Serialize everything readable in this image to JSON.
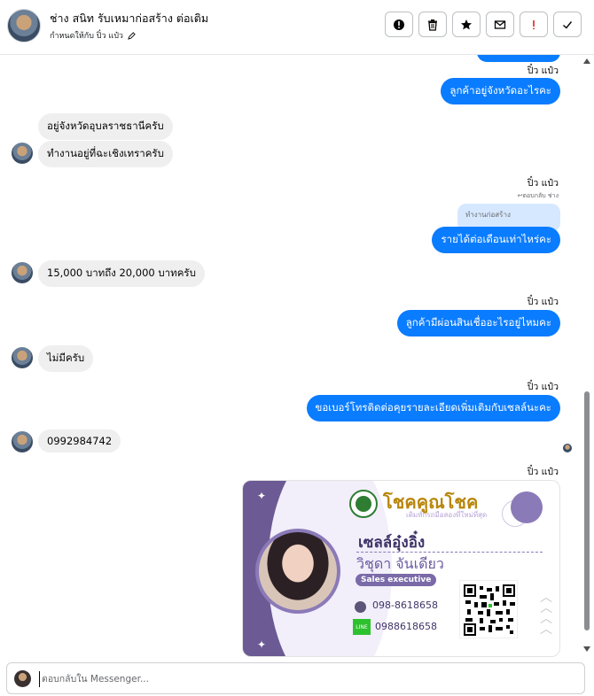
{
  "header": {
    "contact_name": "ช่าง สนิท รับเหมาก่อสร้าง ต่อเติม",
    "nickname_label": "กำหนดให้กับ ปิ๋ว แป๋ว",
    "actions": [
      {
        "name": "report-button",
        "icon": "exclamation-circle-icon"
      },
      {
        "name": "delete-button",
        "icon": "trash-icon"
      },
      {
        "name": "star-button",
        "icon": "star-icon"
      },
      {
        "name": "mark-unread-button",
        "icon": "envelope-icon"
      },
      {
        "name": "spam-button",
        "icon": "exclamation-icon"
      },
      {
        "name": "done-button",
        "icon": "check-icon"
      }
    ]
  },
  "messages": {
    "m1_sender": "ปิ๋ว แป๋ว",
    "m1_text": "ลูกค้าอยู่จังหวัดอะไรคะ",
    "m2_text": "อยู่จังหวัดอุบลราชธานีครับ",
    "m3_text": "ทำงานอยู่ที่ฉะเชิงเทราครับ",
    "m4_sender": "ปิ๋ว แป๋ว",
    "m4_reply_meta": "↩ตอบกลับ ช่าง",
    "m4_quote": "ทำงานก่อสร้าง",
    "m4_text": "รายได้ต่อเดือนเท่าไหร่คะ",
    "m5_text": "15,000 บาทถึง 20,000 บาทครับ",
    "m6_sender": "ปิ๋ว แป๋ว",
    "m6_text": "ลูกค้ามีผ่อนสินเชื่ออะไรอยู่ไหมคะ",
    "m7_text": "ไม่มีครับ",
    "m8_sender": "ปิ๋ว แป๋ว",
    "m8_text": "ขอเบอร์โทรติดต่อคุยรายละเอียดเพิ่มเติมกับเซลล์นะคะ",
    "m9_text": "0992984742",
    "m10_sender": "ปิ๋ว แป๋ว"
  },
  "card": {
    "brand": "โชคคูณโชค",
    "tagline": "เติมทักรถมือสองที่ใหม่ที่สุด",
    "nickname": "เซลล์อุ๋งอิ๋ง",
    "full_name": "วิชุดา จันเดียว",
    "role": "Sales executive",
    "phone": "098-8618658",
    "line_label": "LINE",
    "line_id": "0988618658"
  },
  "composer": {
    "placeholder": "ตอบกลับใน Messenger..."
  },
  "colors": {
    "outgoing_bubble": "#0a7cff",
    "incoming_bubble": "#efefef",
    "card_accent": "#6b5a93"
  }
}
